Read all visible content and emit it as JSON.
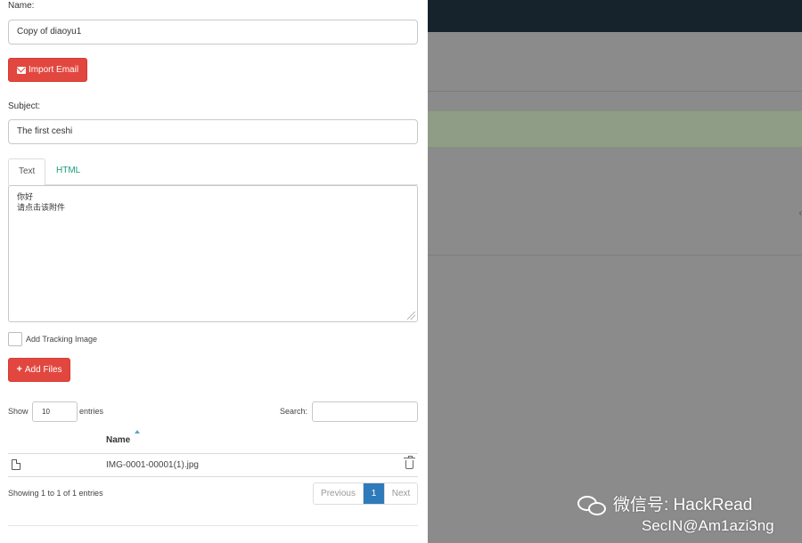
{
  "form": {
    "name_label": "Name:",
    "name_value": "Copy of diaoyu1",
    "import_email_label": "Import Email",
    "subject_label": "Subject:",
    "subject_value": "The first ceshi",
    "tabs": [
      {
        "label": "Text",
        "active": true
      },
      {
        "label": "HTML",
        "active": false
      }
    ],
    "body_lines": [
      "你好",
      "请点击该附件"
    ],
    "tracking_label": "Add Tracking Image",
    "add_files_label": "Add Files"
  },
  "files_table": {
    "show_label": "Show",
    "length_value": "10",
    "entries_label": "entries",
    "search_label": "Search:",
    "column_name": "Name",
    "rows": [
      {
        "name": "IMG-0001-00001(1).jpg"
      }
    ],
    "info": "Showing 1 to 1 of 1 entries",
    "pagination": {
      "previous": "Previous",
      "current": "1",
      "next": "Next"
    }
  },
  "watermark": {
    "line1": "微信号: HackRead",
    "line2": "SecIN@Am1azi3ng"
  },
  "icons": [
    "envelope-icon",
    "plus-icon",
    "file-icon",
    "trash-icon",
    "sort-asc-icon",
    "wechat-icon"
  ],
  "colors": {
    "button_red": "#e2473f",
    "link_teal": "#1a9b7a",
    "pager_active": "#2f7ab9",
    "navbar_dark": "#16222c"
  }
}
